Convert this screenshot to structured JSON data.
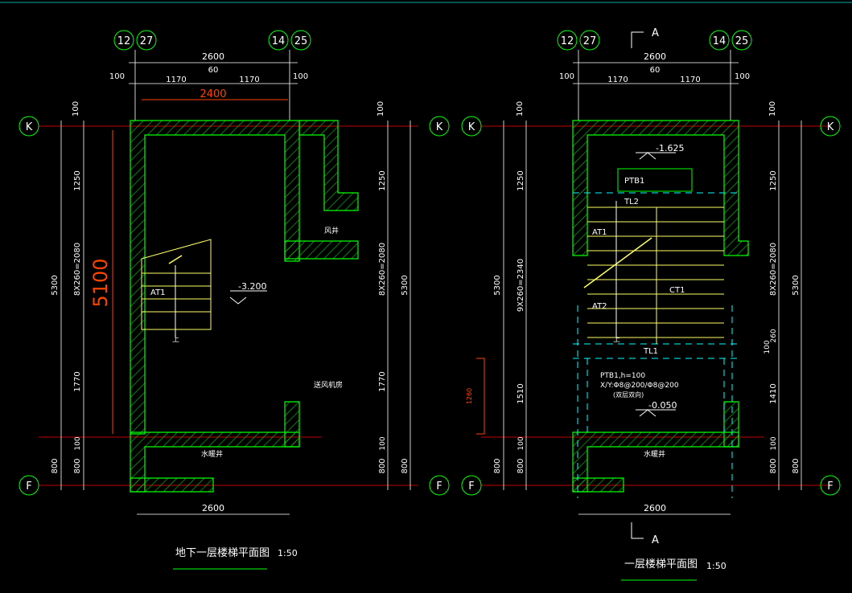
{
  "left": {
    "grid_top": [
      "12",
      "27",
      "14",
      "25"
    ],
    "grid_side": [
      "K",
      "F"
    ],
    "dims_top": {
      "overall": "2600",
      "left_edge": "100",
      "left_span": "1170",
      "center": "60",
      "right_span": "1170",
      "right_edge": "100",
      "inner": "2400"
    },
    "dims_side": {
      "top_edge": "100",
      "upper": "1250",
      "flight": "8X260=2080",
      "middle": "1770",
      "landing": "100",
      "bottom": "800",
      "total": "5300"
    },
    "big_dim": "5100",
    "labels": {
      "flight": "AT1",
      "elevation": "-3.200",
      "vent_shaft": "风井",
      "room": "送风机房",
      "water_well": "水暖井",
      "up_mark": "上"
    },
    "dim_bottom": "2600",
    "title": "地下一层楼梯平面图",
    "scale": "1:50"
  },
  "right": {
    "grid_top": [
      "12",
      "27",
      "14",
      "25"
    ],
    "grid_side": [
      "K",
      "F"
    ],
    "section_mark": "A",
    "dims_top": {
      "overall": "2600",
      "left_edge": "100",
      "left_span": "1170",
      "center": "60",
      "right_span": "1170",
      "right_edge": "100"
    },
    "dims_side_left": {
      "top_edge": "100",
      "upper": "1250",
      "flight": "9X260=2340",
      "lower": "1510",
      "landing": "100",
      "bottom": "800",
      "total": "5300"
    },
    "dims_side_right": {
      "top_edge": "100",
      "upper": "1250",
      "flight": "8X260=2080",
      "small1": "260",
      "small2": "100",
      "lower": "1410",
      "landing": "100",
      "bottom": "800",
      "total": "5300"
    },
    "labels": {
      "elevation_top": "-1.625",
      "ptb": "PTB1",
      "tl2": "TL2",
      "at1": "AT1",
      "at2": "AT2",
      "tl1": "TL1",
      "ct1": "CT1",
      "ptb_note1": "PTB1,h=100",
      "ptb_note2": "X/Y:Φ8@200/Φ8@200",
      "ptb_note3": "(双层双向)",
      "elevation_bottom": "-0.050",
      "water_well": "水暖井",
      "red_dim": "1260",
      "up_mark": "上"
    },
    "dim_bottom": "2600",
    "title": "一层楼梯平面图",
    "scale": "1:50"
  },
  "colors": {
    "grid_circle": "#00ff00",
    "wall": "#00ff00",
    "hatch": "#00ff00",
    "axis_red": "#ff0000",
    "dim_white": "#ffffff",
    "stair_yellow": "#ffff66",
    "dashed_cyan": "#00ffff",
    "red_dim": "#ff4400"
  }
}
